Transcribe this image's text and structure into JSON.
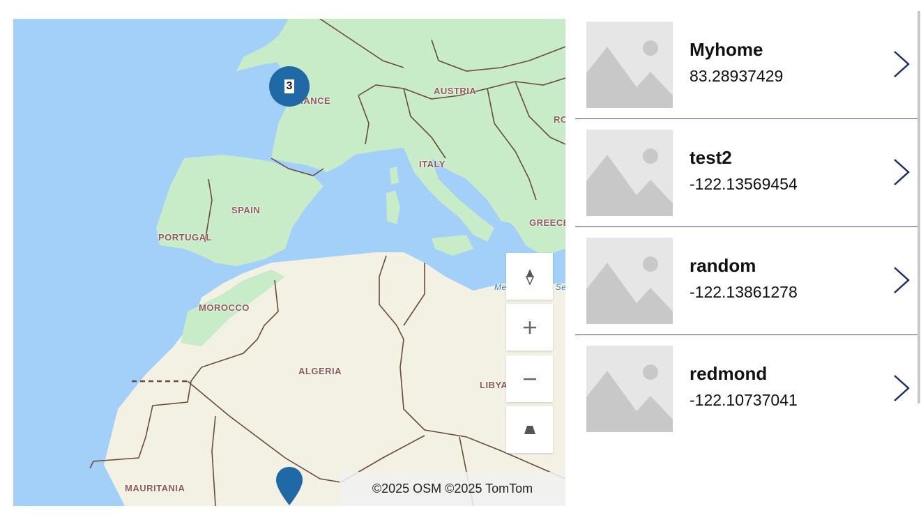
{
  "map": {
    "cluster_count": "3",
    "attribution": "©2025 OSM  ©2025 TomTom",
    "labels": {
      "france": "FRANCE",
      "austria": "AUSTRIA",
      "ro": "RO",
      "italy": "ITALY",
      "spain": "SPAIN",
      "portugal": "PORTUGAL",
      "greece": "GREECE",
      "morocco": "MOROCCO",
      "algeria": "ALGERIA",
      "libya": "LIBYA",
      "mauritania": "MAURITANIA",
      "med_sea": "Mediterranean Sea"
    },
    "controls": [
      "compass-icon",
      "zoom-in-icon",
      "zoom-out-icon",
      "pitch-icon"
    ]
  },
  "list": {
    "items": [
      {
        "title": "Myhome",
        "subtitle": "83.28937429"
      },
      {
        "title": "test2",
        "subtitle": "-122.13569454"
      },
      {
        "title": "random",
        "subtitle": "-122.13861278"
      },
      {
        "title": "redmond",
        "subtitle": "-122.10737041"
      }
    ]
  },
  "colors": {
    "water": "#a3d0f8",
    "land": "#f3f0e4",
    "green_land": "#c8ebc8",
    "cluster": "#1f6aa6",
    "divider": "#3d4a6b",
    "chevron": "#1a2f6b"
  }
}
